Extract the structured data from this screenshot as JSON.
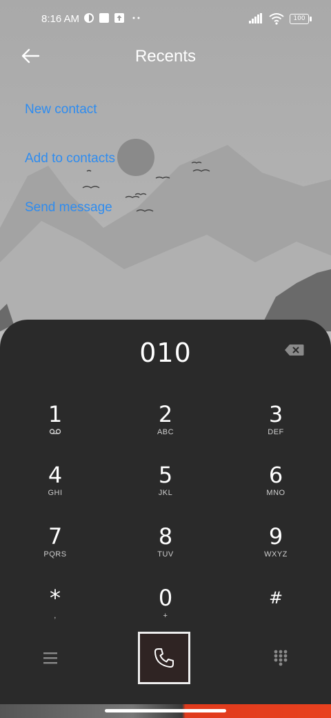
{
  "status": {
    "time": "8:16 AM",
    "battery": "100"
  },
  "header": {
    "title": "Recents",
    "back_icon": "arrow-left-icon"
  },
  "actions": [
    "New contact",
    "Add to contacts",
    "Send message"
  ],
  "dialer": {
    "number": "010",
    "keys": [
      {
        "digit": "1",
        "letters": ""
      },
      {
        "digit": "2",
        "letters": "ABC"
      },
      {
        "digit": "3",
        "letters": "DEF"
      },
      {
        "digit": "4",
        "letters": "GHI"
      },
      {
        "digit": "5",
        "letters": "JKL"
      },
      {
        "digit": "6",
        "letters": "MNO"
      },
      {
        "digit": "7",
        "letters": "PQRS"
      },
      {
        "digit": "8",
        "letters": "TUV"
      },
      {
        "digit": "9",
        "letters": "WXYZ"
      },
      {
        "digit": "*",
        "letters": ","
      },
      {
        "digit": "0",
        "letters": "+"
      },
      {
        "digit": "#",
        "letters": ""
      }
    ]
  },
  "colors": {
    "link": "#2e8cf0",
    "pad_bg": "#2a2a2a"
  }
}
